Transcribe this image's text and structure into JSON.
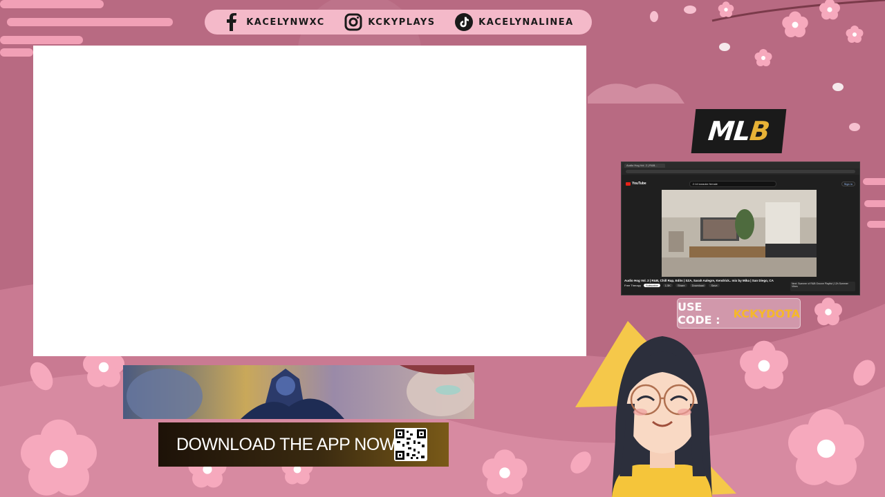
{
  "social_bar": {
    "items": [
      {
        "icon": "facebook-icon",
        "handle": "KACELYNWXC"
      },
      {
        "icon": "instagram-icon",
        "handle": "KCKYPLAYS"
      },
      {
        "icon": "tiktok-icon",
        "handle": "KACELYNALINEA"
      }
    ]
  },
  "sponsor": {
    "logo_text_main": "ML",
    "logo_text_accent": "B",
    "code_label": "USE CODE :",
    "code_value": "KCKYDOTA"
  },
  "browser": {
    "tab_title": "Audio Hog Vol. 2 | R&B...",
    "youtube_logo": "YouTube",
    "search_query": "2:14 karaoke female",
    "sign_in": "Sign in",
    "video_title": "Audio Hog Vol. 2 | R&B, Chill Rap, Edits | SZA, Sarah Aalegre, Kendrick.. mix by Mika | San Diego, CA",
    "channel": "Free Therapy",
    "subscribe": "Subscribe",
    "likes": "1.5K",
    "share": "Share",
    "download": "Download",
    "save": "Save",
    "up_next": "Next: Summer of R&B Groove Playlist | 12h Summer Vibes"
  },
  "cta": {
    "text": "DOWNLOAD THE APP NOW!"
  },
  "colors": {
    "background": "#b86a82",
    "pill": "#f4b9c9",
    "accent_gold": "#f5b82a",
    "blossom": "#f6a9bd"
  }
}
